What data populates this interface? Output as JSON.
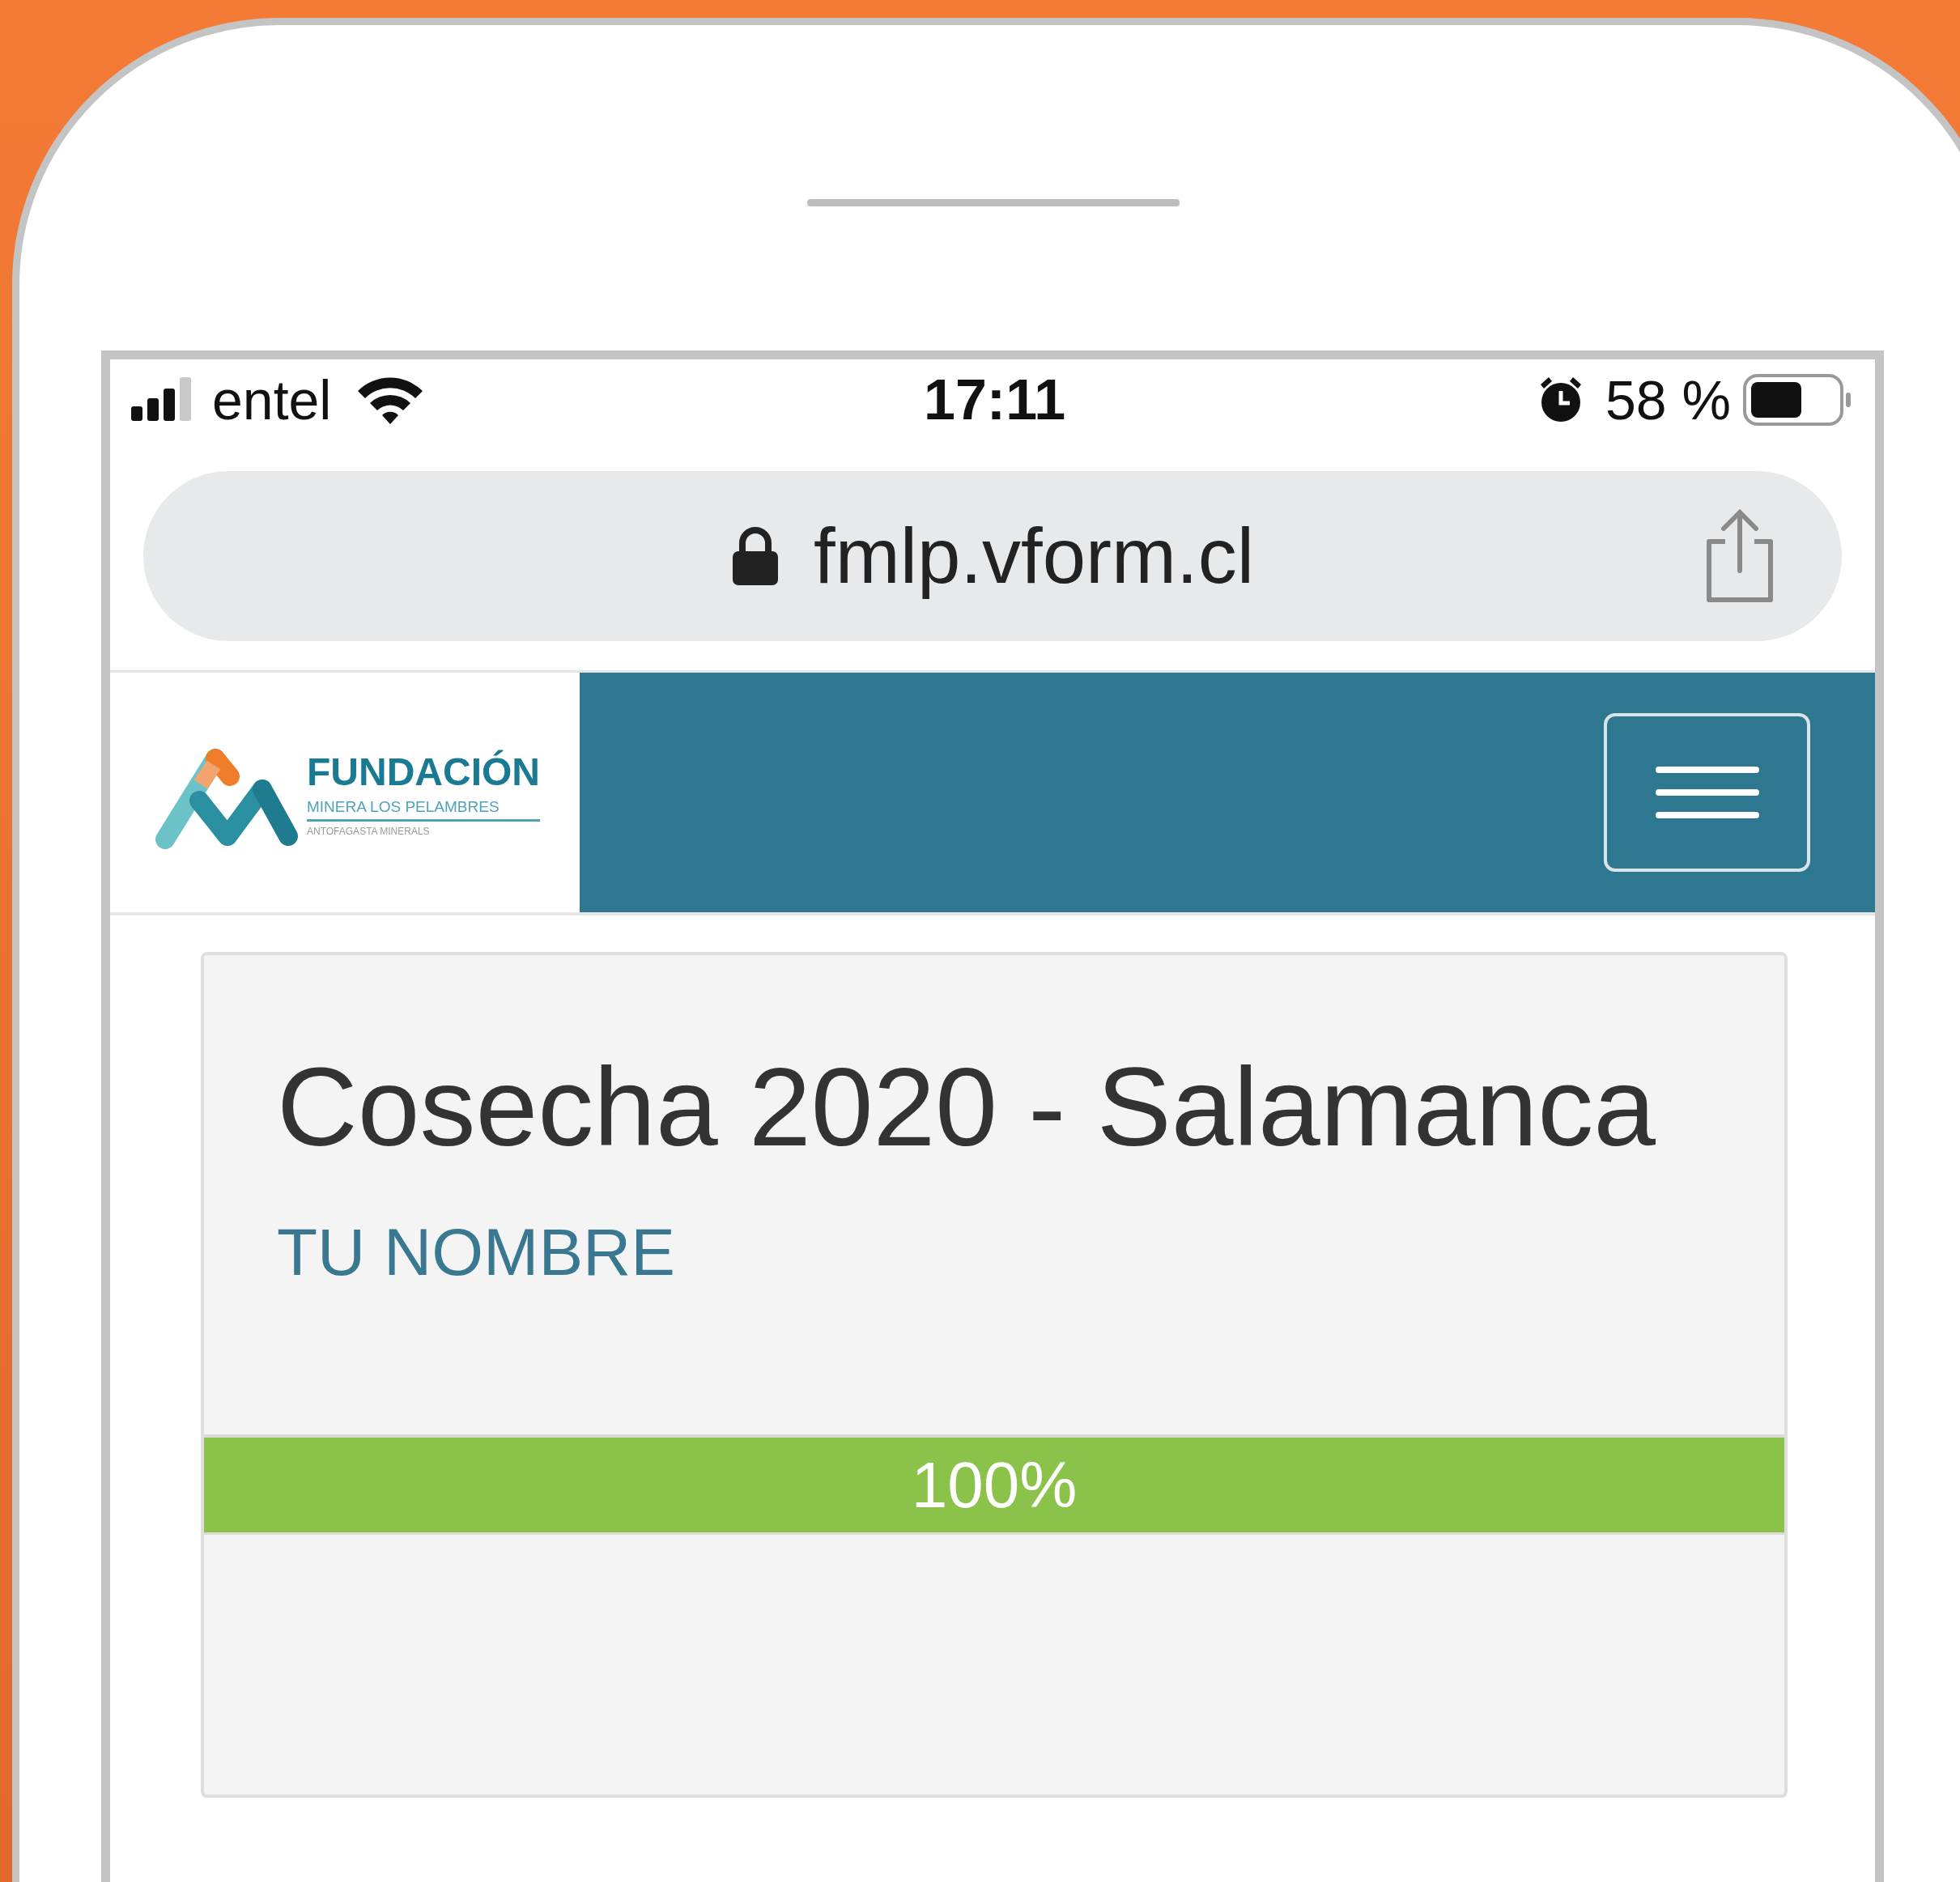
{
  "status_bar": {
    "carrier": "entel",
    "time": "17:11",
    "battery": "58 %"
  },
  "address_bar": {
    "url": "fmlp.vform.cl"
  },
  "logo": {
    "title": "FUNDACIÓN",
    "subtitle": "MINERA LOS PELAMBRES",
    "tagline": "ANTOFAGASTA MINERALS"
  },
  "card": {
    "title": "Cosecha 2020 - Salamanca",
    "subtitle": "TU NOMBRE",
    "progress": {
      "level": 1,
      "label": "100%"
    }
  }
}
